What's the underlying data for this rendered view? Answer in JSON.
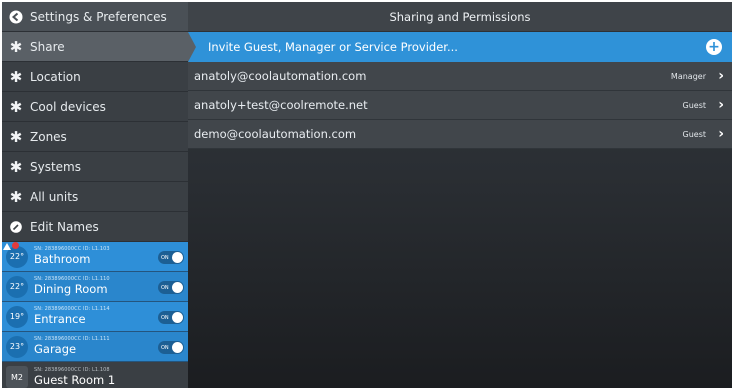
{
  "sidebar": {
    "header": {
      "label": "Settings & Preferences",
      "icon": "back-arrow-icon"
    },
    "items": [
      {
        "label": "Share",
        "icon": "gear-icon",
        "active": true
      },
      {
        "label": "Location",
        "icon": "gear-icon"
      },
      {
        "label": "Cool devices",
        "icon": "gear-icon"
      },
      {
        "label": "Zones",
        "icon": "gear-icon"
      },
      {
        "label": "Systems",
        "icon": "gear-icon"
      },
      {
        "label": "All units",
        "icon": "gear-icon"
      },
      {
        "label": "Edit Names",
        "icon": "pencil-icon"
      }
    ],
    "units": [
      {
        "temp": "22°",
        "sn": "SN: 283896000CC ID: L1.103",
        "name": "Bathroom",
        "toggle": "ON",
        "alert": true
      },
      {
        "temp": "22°",
        "sn": "SN: 283896000CC ID: L1.110",
        "name": "Dining Room",
        "toggle": "ON"
      },
      {
        "temp": "19°",
        "sn": "SN: 283896000CC ID: L1.114",
        "name": "Entrance",
        "toggle": "ON"
      },
      {
        "temp": "23°",
        "sn": "SN: 283896000CC ID: L1.111",
        "name": "Garage",
        "toggle": "ON"
      },
      {
        "temp": "M2",
        "sn": "SN: 283896000CC ID: L1.108",
        "name": "Guest Room 1"
      }
    ]
  },
  "main": {
    "title": "Sharing and Permissions",
    "invite_label": "Invite Guest, Manager or Service Provider...",
    "users": [
      {
        "email": "anatoly@coolautomation.com",
        "role": "Manager"
      },
      {
        "email": "anatoly+test@coolremote.net",
        "role": "Guest"
      },
      {
        "email": "demo@coolautomation.com",
        "role": "Guest"
      }
    ]
  },
  "colors": {
    "accent": "#2f92d8",
    "sidebar_bg": "#3a3f44",
    "alert": "#e23b3b"
  }
}
